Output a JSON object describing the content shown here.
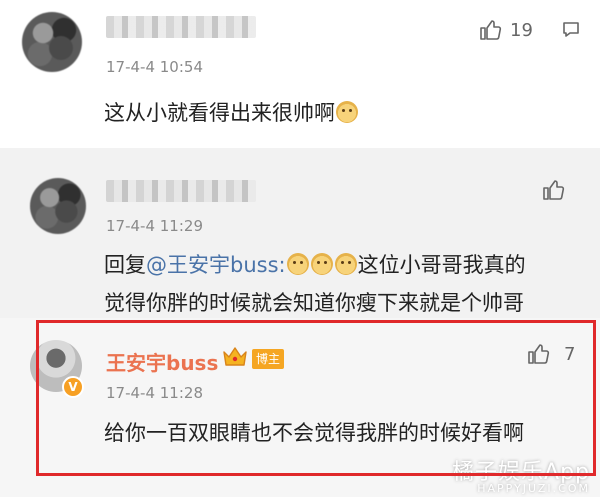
{
  "comments": [
    {
      "timestamp": "17-4-4 10:54",
      "text": "这从小就看得出来很帅啊",
      "like_count": "19"
    },
    {
      "timestamp": "17-4-4 11:29",
      "reply_prefix": "回复",
      "mention": "@王安宇buss",
      "colon": ":",
      "text_line1": "这位小哥哥我真的",
      "text_line2": "觉得你胖的时候就会知道你瘦下来就是个帅哥"
    },
    {
      "author": "王安宇buss",
      "badge": "博主",
      "verified_mark": "V",
      "timestamp": "17-4-4 11:28",
      "text": "给你一百双眼睛也不会觉得我胖的时候好看啊",
      "like_count": "7"
    }
  ],
  "watermark": {
    "line1": "橘子娱乐App",
    "line2": "HAPPYJUZI.COM"
  },
  "colors": {
    "author_name": "#eb7350",
    "mention": "#4a73a8",
    "highlight_border": "#e0292b",
    "badge": "#f5a623"
  }
}
